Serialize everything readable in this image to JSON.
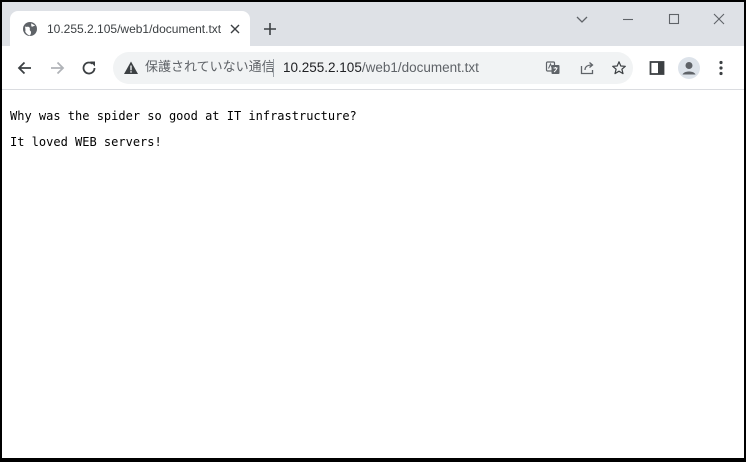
{
  "tab": {
    "title": "10.255.2.105/web1/document.txt",
    "favicon": "globe-icon"
  },
  "omnibox": {
    "security_text": "保護されていない通信",
    "url_host": "10.255.2.105",
    "url_path": "/web1/document.txt"
  },
  "document": {
    "lines": [
      "Why was the spider so good at IT infrastructure?",
      "It loved WEB servers!"
    ]
  },
  "colors": {
    "tabstrip": "#dee1e6",
    "omnibox": "#f1f3f4",
    "icon": "#5f6368"
  }
}
